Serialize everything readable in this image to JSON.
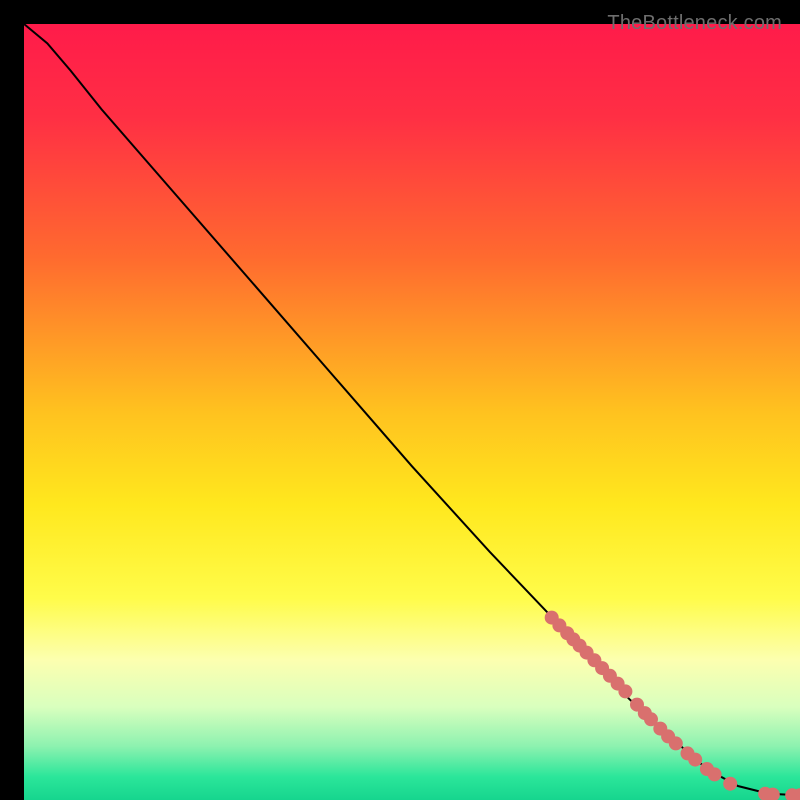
{
  "watermark": "TheBottleneck.com",
  "colors": {
    "marker": "#d9706e",
    "line": "#000000",
    "bg_black": "#000000"
  },
  "chart_data": {
    "type": "line",
    "title": "",
    "xlabel": "",
    "ylabel": "",
    "xlim": [
      0,
      100
    ],
    "ylim": [
      0,
      100
    ],
    "gradient_stops": [
      {
        "pct": 0,
        "color": "#ff1b4a"
      },
      {
        "pct": 12,
        "color": "#ff2f44"
      },
      {
        "pct": 30,
        "color": "#ff6a2f"
      },
      {
        "pct": 50,
        "color": "#ffc21f"
      },
      {
        "pct": 62,
        "color": "#ffe81e"
      },
      {
        "pct": 74,
        "color": "#fffc4a"
      },
      {
        "pct": 82,
        "color": "#fcffb0"
      },
      {
        "pct": 88,
        "color": "#d9ffbe"
      },
      {
        "pct": 93,
        "color": "#8ef2b0"
      },
      {
        "pct": 97,
        "color": "#2be69a"
      },
      {
        "pct": 100,
        "color": "#16d58e"
      }
    ],
    "curve_points": [
      {
        "x": 0.0,
        "y": 100.0
      },
      {
        "x": 3.0,
        "y": 97.5
      },
      {
        "x": 6.0,
        "y": 94.0
      },
      {
        "x": 10.0,
        "y": 89.0
      },
      {
        "x": 20.0,
        "y": 77.5
      },
      {
        "x": 30.0,
        "y": 66.0
      },
      {
        "x": 40.0,
        "y": 54.5
      },
      {
        "x": 50.0,
        "y": 43.0
      },
      {
        "x": 60.0,
        "y": 32.0
      },
      {
        "x": 70.0,
        "y": 21.5
      },
      {
        "x": 78.0,
        "y": 13.0
      },
      {
        "x": 84.0,
        "y": 7.5
      },
      {
        "x": 88.0,
        "y": 4.0
      },
      {
        "x": 92.0,
        "y": 1.8
      },
      {
        "x": 96.0,
        "y": 0.8
      },
      {
        "x": 100.0,
        "y": 0.6
      }
    ],
    "markers": [
      {
        "x": 68.0,
        "y": 23.5
      },
      {
        "x": 69.0,
        "y": 22.5
      },
      {
        "x": 70.0,
        "y": 21.5
      },
      {
        "x": 70.8,
        "y": 20.7
      },
      {
        "x": 71.6,
        "y": 19.9
      },
      {
        "x": 72.5,
        "y": 19.0
      },
      {
        "x": 73.5,
        "y": 18.0
      },
      {
        "x": 74.5,
        "y": 17.0
      },
      {
        "x": 75.5,
        "y": 16.0
      },
      {
        "x": 76.5,
        "y": 15.0
      },
      {
        "x": 77.5,
        "y": 14.0
      },
      {
        "x": 79.0,
        "y": 12.3
      },
      {
        "x": 80.0,
        "y": 11.2
      },
      {
        "x": 80.8,
        "y": 10.4
      },
      {
        "x": 82.0,
        "y": 9.2
      },
      {
        "x": 83.0,
        "y": 8.2
      },
      {
        "x": 84.0,
        "y": 7.3
      },
      {
        "x": 85.5,
        "y": 6.0
      },
      {
        "x": 86.5,
        "y": 5.2
      },
      {
        "x": 88.0,
        "y": 4.0
      },
      {
        "x": 89.0,
        "y": 3.3
      },
      {
        "x": 91.0,
        "y": 2.1
      },
      {
        "x": 95.5,
        "y": 0.8
      },
      {
        "x": 96.5,
        "y": 0.7
      },
      {
        "x": 99.0,
        "y": 0.6
      },
      {
        "x": 100.0,
        "y": 0.6
      }
    ]
  }
}
